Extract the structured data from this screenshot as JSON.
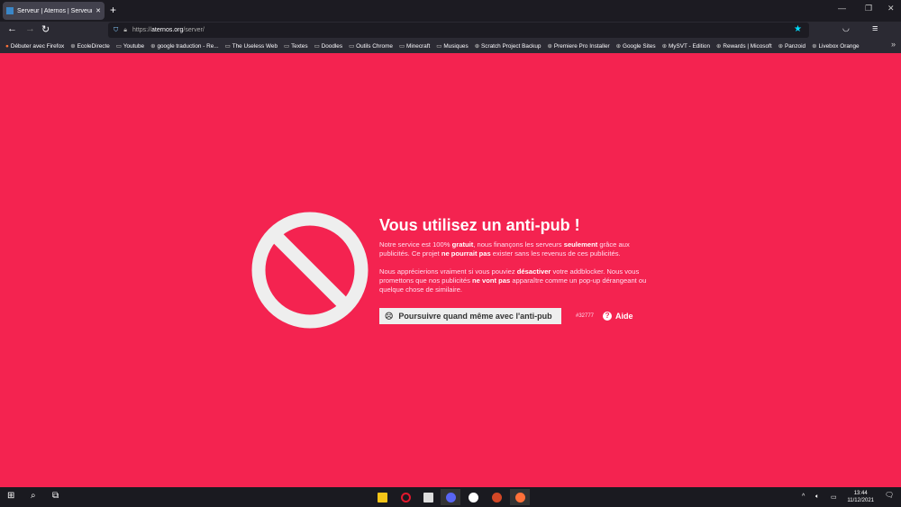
{
  "browser": {
    "tab_title": "Serveur | Aternos | Serveur Minecraft",
    "url_domain": "aternos.org",
    "url_prefix": "https://",
    "url_path": "/server/",
    "bookmarks": [
      "Débuter avec Firefox",
      "EcoleDirecte",
      "Youtube",
      "google traduction - Re...",
      "The Useless Web",
      "Textes",
      "Doodles",
      "Outils Chrome",
      "Minecraft",
      "Musiques",
      "Scratch Project Backup",
      "Premiere Pro Installer",
      "Google Sites",
      "MySVT - Edition",
      "Rewards | Micosoft",
      "Panzoid",
      "Livebox Orange"
    ]
  },
  "page": {
    "title": "Vous utilisez un anti-pub !",
    "p1": [
      "Notre service est 100% ",
      "gratuit",
      ", nous finançons les serveurs ",
      "seulement",
      " grâce aux publicités. Ce projet ",
      "ne pourrait pas",
      " exister sans les revenus de ces publicités."
    ],
    "p2": [
      "Nous apprécierions vraiment si vous pouviez ",
      "désactiver",
      " votre addblocker. Nous vous promettons que nos publicités ",
      "ne vont pas",
      " apparaître comme un pop-up dérangeant ou quelque chose de similaire."
    ],
    "continue_button": "Poursuivre quand même avec l'anti-pub",
    "id": "#32777",
    "help": "Aide"
  },
  "taskbar": {
    "time": "13:44",
    "date": "11/12/2021"
  },
  "colors": {
    "background": "#f42350"
  }
}
